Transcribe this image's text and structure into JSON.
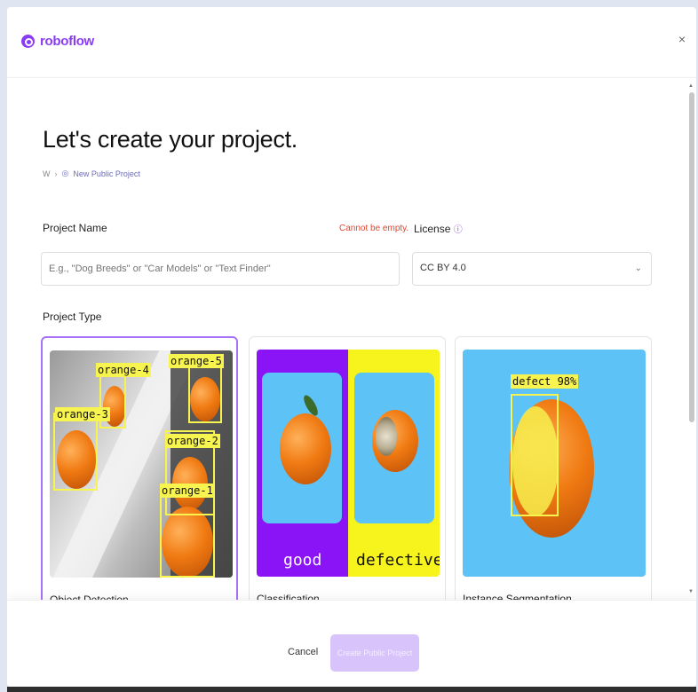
{
  "app": {
    "brand": "roboflow",
    "close_symbol": "×"
  },
  "page": {
    "title": "Let's create your project.",
    "breadcrumb": {
      "home": "W",
      "separator": "›",
      "current": "New Public Project"
    }
  },
  "form": {
    "project_name_label": "Project Name",
    "project_name_error": "Cannot be empty.",
    "project_name_placeholder": "E.g., \"Dog Breeds\" or \"Car Models\" or \"Text Finder\"",
    "license_label": "License",
    "license_info_symbol": "ⓘ",
    "license_value": "CC BY 4.0",
    "project_type_label": "Project Type"
  },
  "project_types": [
    {
      "label": "Object Detection",
      "selected": true,
      "tags": [
        "orange-4",
        "orange-5",
        "orange-3",
        "orange-2",
        "orange-1"
      ]
    },
    {
      "label": "Classification",
      "selected": false,
      "captions": [
        "good",
        "defective"
      ]
    },
    {
      "label": "Instance Segmentation",
      "selected": false,
      "tag": "defect 98%"
    }
  ],
  "footer": {
    "cancel_label": "Cancel",
    "create_label": "Create Public Project"
  },
  "colors": {
    "accent": "#8a3bf5",
    "error": "#e0452f",
    "label_yellow": "#f7f34f",
    "sky_blue": "#5dc3f7",
    "purple": "#8b14f7"
  }
}
